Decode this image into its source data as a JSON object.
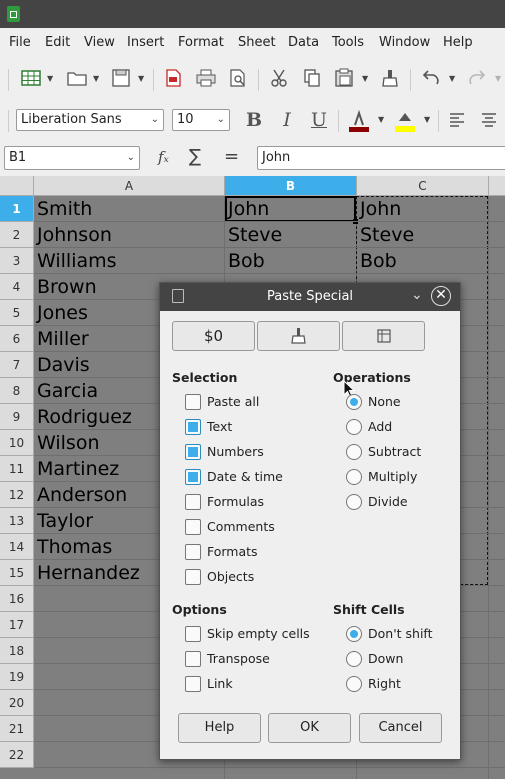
{
  "menubar": {
    "items": [
      "File",
      "Edit",
      "View",
      "Insert",
      "Format",
      "Sheet",
      "Data",
      "Tools",
      "Window",
      "Help"
    ]
  },
  "format_toolbar": {
    "font_name": "Liberation Sans",
    "font_size": "10",
    "bold_label": "B",
    "italic_label": "I",
    "underline_label": "U"
  },
  "formula_bar": {
    "name_box": "B1",
    "function_wizard": "fₓ",
    "sum_symbol": "∑",
    "equals_symbol": "=",
    "content": "John"
  },
  "sheet": {
    "columns": [
      "A",
      "B",
      "C"
    ],
    "rows": [
      "1",
      "2",
      "3",
      "4",
      "5",
      "6",
      "7",
      "8",
      "9",
      "10",
      "11",
      "12",
      "13",
      "14",
      "15",
      "16",
      "17",
      "18",
      "19",
      "20",
      "21",
      "22"
    ],
    "col_a": [
      "Smith",
      "Johnson",
      "Williams",
      "Brown",
      "Jones",
      "Miller",
      "Davis",
      "Garcia",
      "Rodriguez",
      "Wilson",
      "Martinez",
      "Anderson",
      "Taylor",
      "Thomas",
      "Hernandez"
    ],
    "col_b": [
      "John",
      "Steve",
      "Bob"
    ],
    "col_c": [
      "John",
      "Steve",
      "Bob"
    ],
    "selected_cell": "B1"
  },
  "dialog": {
    "title": "Paste Special",
    "preset_buttons": [
      "$0"
    ],
    "selection_title": "Selection",
    "selection": [
      {
        "label": "Paste all",
        "checked": false
      },
      {
        "label": "Text",
        "checked": true
      },
      {
        "label": "Numbers",
        "checked": true
      },
      {
        "label": "Date & time",
        "checked": true
      },
      {
        "label": "Formulas",
        "checked": false
      },
      {
        "label": "Comments",
        "checked": false
      },
      {
        "label": "Formats",
        "checked": false
      },
      {
        "label": "Objects",
        "checked": false
      }
    ],
    "operations_title": "Operations",
    "operations": [
      {
        "label": "None",
        "selected": true
      },
      {
        "label": "Add",
        "selected": false
      },
      {
        "label": "Subtract",
        "selected": false
      },
      {
        "label": "Multiply",
        "selected": false
      },
      {
        "label": "Divide",
        "selected": false
      }
    ],
    "options_title": "Options",
    "options": [
      {
        "label": "Skip empty cells",
        "checked": false
      },
      {
        "label": "Transpose",
        "checked": false
      },
      {
        "label": "Link",
        "checked": false
      }
    ],
    "shift_title": "Shift Cells",
    "shift": [
      {
        "label": "Don't shift",
        "selected": true
      },
      {
        "label": "Down",
        "selected": false
      },
      {
        "label": "Right",
        "selected": false
      }
    ],
    "help_label": "Help",
    "ok_label": "OK",
    "cancel_label": "Cancel"
  },
  "colors": {
    "accent": "#3daee9",
    "app_green": "#2e9c3a",
    "font_color_swatch": "#8b0000",
    "highlight_swatch": "#ffff00"
  }
}
